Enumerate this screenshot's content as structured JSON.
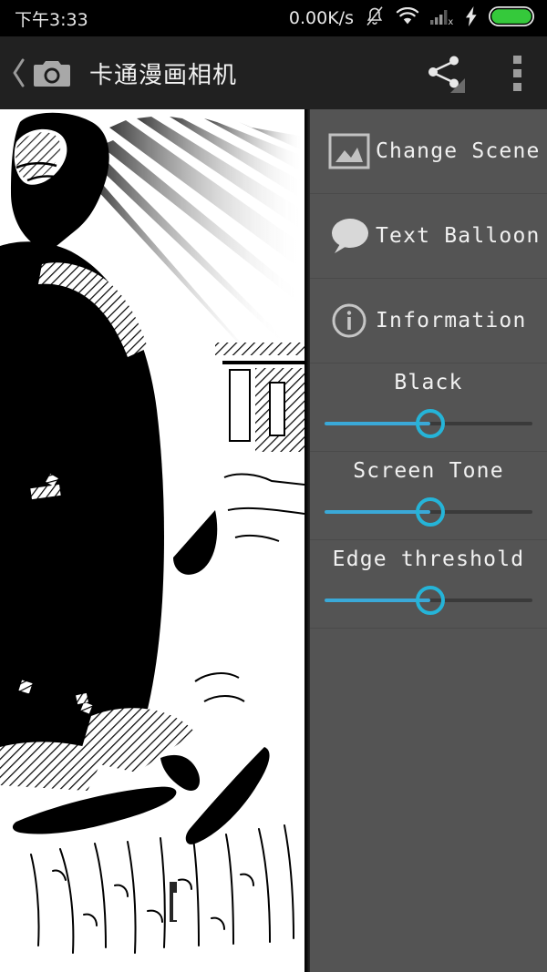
{
  "status_bar": {
    "clock": "下午3:33",
    "net_speed": "0.00K/s",
    "icons": [
      "notification-muted-icon",
      "wifi-icon",
      "signal-no-service-icon",
      "charging-bolt-icon",
      "battery-full-icon"
    ],
    "battery_color": "#35c93b"
  },
  "title_bar": {
    "back_label": "‹",
    "app_icon": "camera-icon",
    "title": "卡通漫画相机",
    "share_label": "share-icon",
    "overflow_label": "overflow-menu-icon",
    "background": "#212121"
  },
  "photo": {
    "description": "manga-style black-and-white comic filtered photo",
    "background": "#ffffff"
  },
  "panel": {
    "background": "#545454",
    "menu": [
      {
        "icon": "image-picture-icon",
        "label": "Change Scene"
      },
      {
        "icon": "speech-bubble-icon",
        "label": "Text Balloon"
      },
      {
        "icon": "info-circle-icon",
        "label": "Information"
      }
    ],
    "sliders": [
      {
        "label": "Black",
        "value": 51,
        "min": 0,
        "max": 100
      },
      {
        "label": "Screen Tone",
        "value": 51,
        "min": 0,
        "max": 100
      },
      {
        "label": "Edge threshold",
        "value": 51,
        "min": 0,
        "max": 100
      }
    ],
    "accent_color": "#25b4d8",
    "track_fill_color": "#3aa9d8",
    "track_bg_color": "#3a3a3a"
  }
}
